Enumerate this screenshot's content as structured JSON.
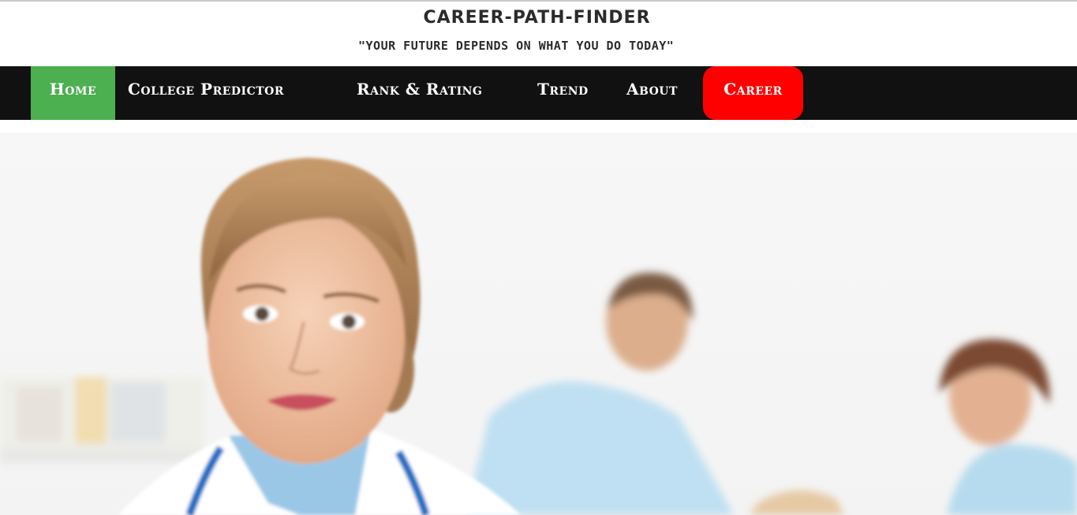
{
  "header": {
    "title": "CAREER-PATH-FINDER",
    "tagline": "\"YOUR FUTURE DEPENDS ON WHAT YOU DO TODAY\""
  },
  "nav": {
    "items": [
      {
        "label": "Home",
        "active": true
      },
      {
        "label": "College Predictor"
      },
      {
        "label": "Rank & Rating"
      },
      {
        "label": "Trend"
      },
      {
        "label": "About"
      },
      {
        "label": "Career",
        "highlight": true
      }
    ]
  },
  "colors": {
    "nav_bg": "#111111",
    "active": "#4caf50",
    "career_highlight": "#ff0000"
  },
  "hero": {
    "image": "doctors-photo"
  }
}
